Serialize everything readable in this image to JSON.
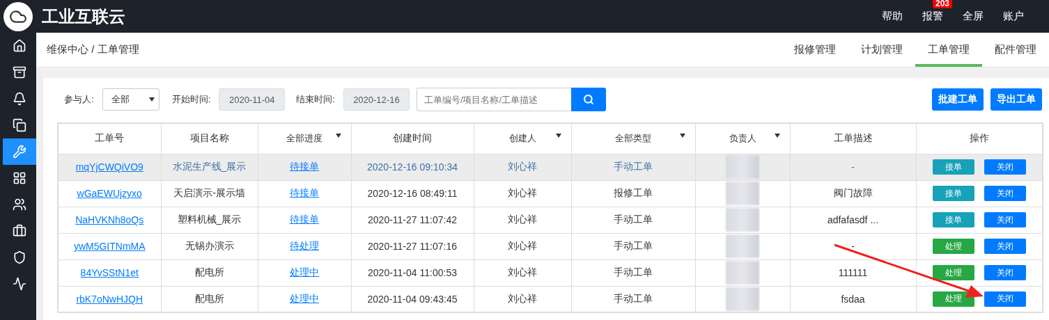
{
  "brand": {
    "title": "工业互联云"
  },
  "top_nav": [
    {
      "label": "帮助"
    },
    {
      "label": "报警",
      "badge": "203"
    },
    {
      "label": "全屏"
    },
    {
      "label": "账户"
    }
  ],
  "sidebar": {
    "items": [
      {
        "selected": false
      },
      {
        "selected": false
      },
      {
        "selected": false
      },
      {
        "selected": false
      },
      {
        "selected": true
      },
      {
        "selected": false
      },
      {
        "selected": false
      },
      {
        "selected": false
      },
      {
        "selected": false
      },
      {
        "selected": false
      }
    ]
  },
  "breadcrumb": "维保中心 / 工单管理",
  "tabs": [
    {
      "label": "报修管理",
      "selected": false
    },
    {
      "label": "计划管理",
      "selected": false
    },
    {
      "label": "工单管理",
      "selected": true
    },
    {
      "label": "配件管理",
      "selected": false
    }
  ],
  "filters": {
    "participant_label": "参与人:",
    "participant_value": "全部",
    "start_label": "开始时间:",
    "start_value": "2020-11-04",
    "end_label": "结束时间:",
    "end_value": "2020-12-16",
    "search_placeholder": "工单编号/项目名称/工单描述"
  },
  "buttons": [
    "批建工单",
    "导出工单"
  ],
  "table": {
    "columns": [
      {
        "label": "工单号",
        "filter": false
      },
      {
        "label": "项目名称",
        "filter": false
      },
      {
        "label": "全部进度",
        "filter": true
      },
      {
        "label": "创建时间",
        "filter": false
      },
      {
        "label": "创建人",
        "filter": true
      },
      {
        "label": "全部类型",
        "filter": true
      },
      {
        "label": "负责人",
        "filter": true
      },
      {
        "label": "工单描述",
        "filter": false
      },
      {
        "label": "操作",
        "filter": false
      }
    ],
    "rows": [
      {
        "selected": true,
        "id": "mqYjCWQiVO9",
        "project": "水泥生产线_展示",
        "progress": "待接单",
        "created": "2020-12-16 09:10:34",
        "creator": "刘心祥",
        "type": "手动工单",
        "description": "-",
        "action": {
          "label": "接单",
          "kind": "accept"
        },
        "close": "关闭"
      },
      {
        "selected": false,
        "id": "wGaEWUjzyxo",
        "project": "天启演示-展示墙",
        "progress": "待接单",
        "created": "2020-12-16 08:49:11",
        "creator": "刘心祥",
        "type": "报修工单",
        "description": "阀门故障",
        "action": {
          "label": "接单",
          "kind": "accept"
        },
        "close": "关闭"
      },
      {
        "selected": false,
        "id": "NaHVKNh8oQs",
        "project": "塑料机械_展示",
        "progress": "待接单",
        "created": "2020-11-27 11:07:42",
        "creator": "刘心祥",
        "type": "手动工单",
        "description": "adfafasdf ...",
        "action": {
          "label": "接单",
          "kind": "accept"
        },
        "close": "关闭"
      },
      {
        "selected": false,
        "id": "ywM5GITNmMA",
        "project": "无锡办演示",
        "progress": "待处理",
        "created": "2020-11-27 11:07:16",
        "creator": "刘心祥",
        "type": "手动工单",
        "description": "-",
        "action": {
          "label": "处理",
          "kind": "process"
        },
        "close": "关闭"
      },
      {
        "selected": false,
        "id": "84YvSStN1et",
        "project": "配电所",
        "progress": "处理中",
        "created": "2020-11-04 11:00:53",
        "creator": "刘心祥",
        "type": "手动工单",
        "description": "111111",
        "action": {
          "label": "处理",
          "kind": "process"
        },
        "close": "关闭"
      },
      {
        "selected": false,
        "id": "rbK7oNwHJQH",
        "project": "配电所",
        "progress": "处理中",
        "created": "2020-11-04 09:43:45",
        "creator": "刘心祥",
        "type": "手动工单",
        "description": "fsdaa",
        "action": {
          "label": "处理",
          "kind": "process"
        },
        "close": "关闭"
      }
    ]
  }
}
